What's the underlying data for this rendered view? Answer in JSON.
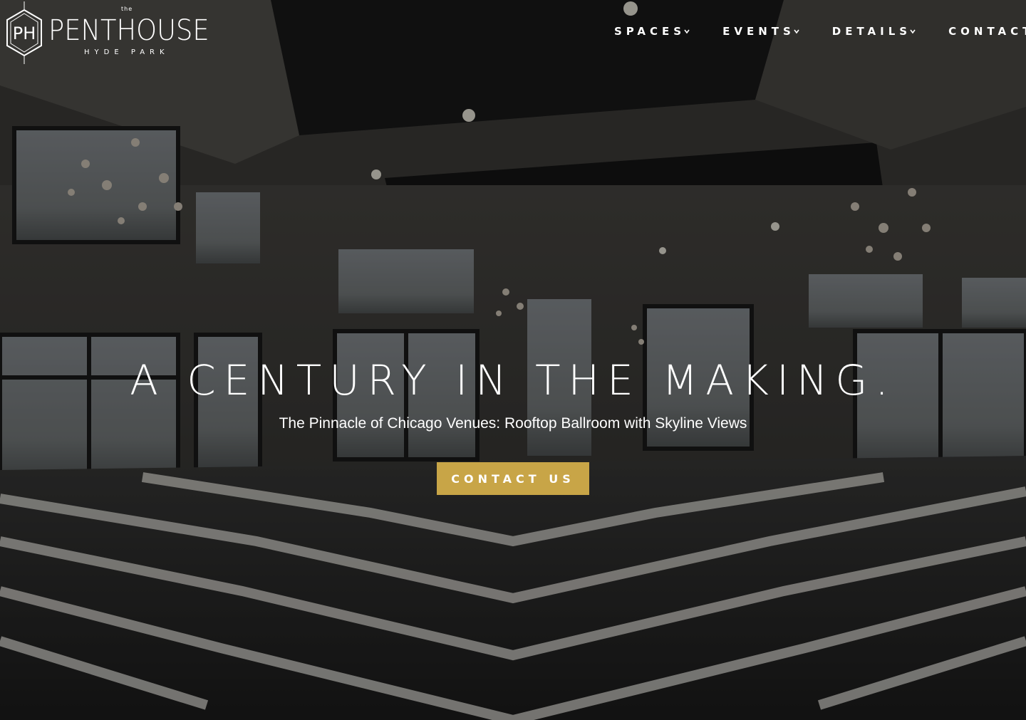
{
  "brand": {
    "monogram": "PH",
    "the": "the",
    "name": "PENTHOUSE",
    "location": "HYDE PARK"
  },
  "nav": {
    "items": [
      {
        "label": "SPACES",
        "has_dropdown": true
      },
      {
        "label": "EVENTS",
        "has_dropdown": true
      },
      {
        "label": "DETAILS",
        "has_dropdown": true
      },
      {
        "label": "CONTACT",
        "has_dropdown": false
      }
    ]
  },
  "hero": {
    "headline": "A CENTURY IN THE MAKING.",
    "subheadline": "The Pinnacle of Chicago Venues: Rooftop Ballroom with Skyline Views",
    "cta_label": "CONTACT US"
  },
  "colors": {
    "accent": "#c8a547",
    "text": "#ffffff",
    "overlay": "#000000"
  }
}
